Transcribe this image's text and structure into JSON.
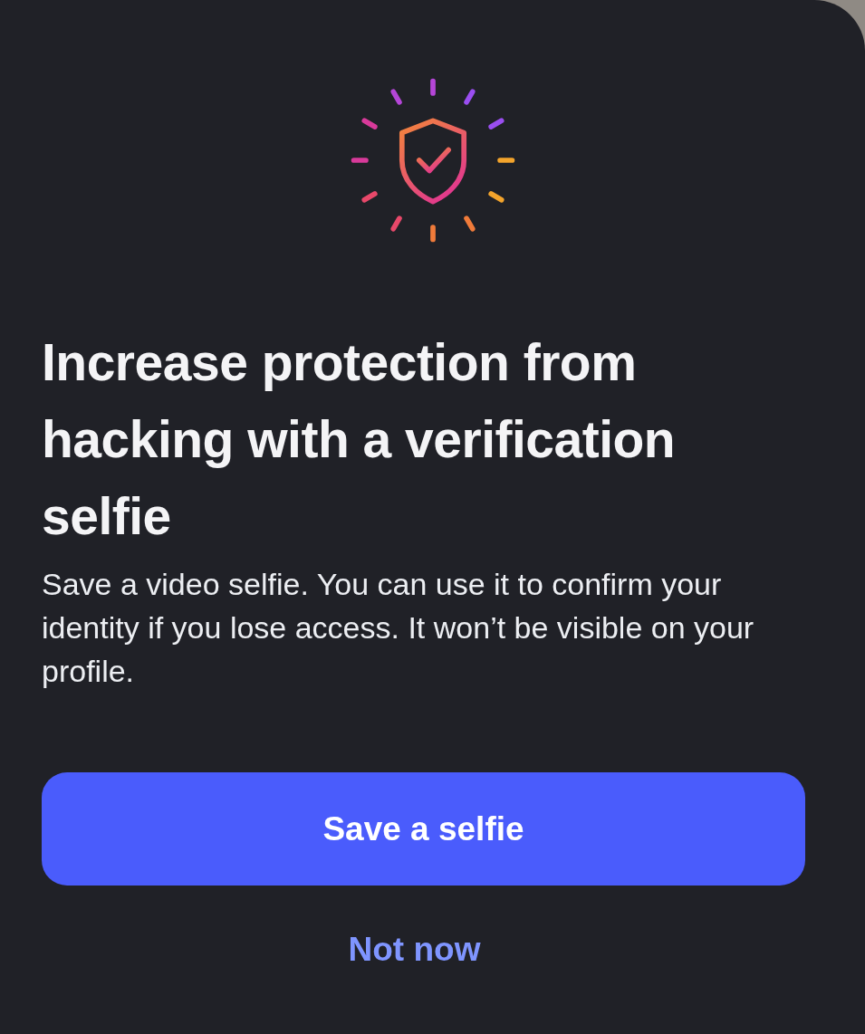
{
  "title": "Increase protection from hacking with a verification selfie",
  "description": "Save a video selfie. You can use it to confirm your identity if you lose access. It won’t be visible on your profile.",
  "primary_button": "Save a selfie",
  "secondary_button": "Not now"
}
